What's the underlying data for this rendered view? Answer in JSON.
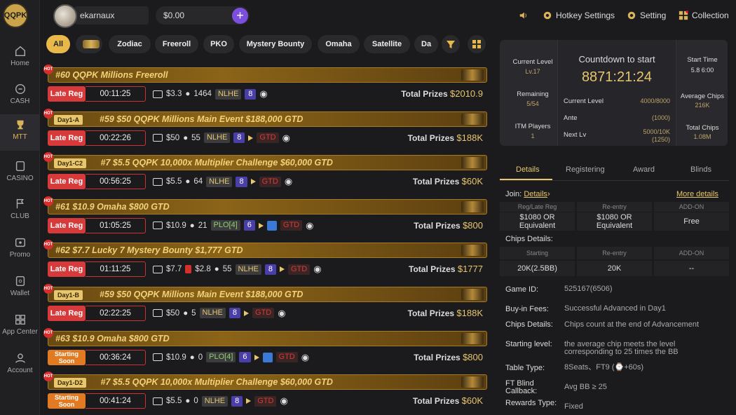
{
  "app": {
    "logo_text": "QQPK"
  },
  "sidebar": {
    "items": [
      {
        "label": "Home",
        "icon": "home-icon"
      },
      {
        "label": "CASH",
        "icon": "cash-icon"
      },
      {
        "label": "MTT",
        "icon": "trophy-icon",
        "active": true
      },
      {
        "label": "CASINO",
        "icon": "casino-icon"
      },
      {
        "label": "CLUB",
        "icon": "flag-icon"
      },
      {
        "label": "Promo",
        "icon": "promo-icon"
      },
      {
        "label": "Wallet",
        "icon": "wallet-icon"
      },
      {
        "label": "App Center",
        "icon": "grid-icon"
      },
      {
        "label": "Account",
        "icon": "user-icon"
      }
    ]
  },
  "header": {
    "username": "ekarnaux",
    "balance": "$0.00",
    "plus": "+",
    "hotkey_label": "Hotkey Settings",
    "setting_label": "Setting",
    "collection_label": "Collection"
  },
  "filters": {
    "chips": [
      "All",
      "Zodiac",
      "Freeroll",
      "PKO",
      "Mystery Bounty",
      "Omaha",
      "Satellite",
      "Da"
    ]
  },
  "tournaments": [
    {
      "stage": "",
      "name": "#60 QQPK Millions Freeroll",
      "reg": "Late Reg",
      "time": "00:11:25",
      "buyin": "$3.3",
      "players": "1464",
      "game": "NLHE",
      "seats": "8",
      "extras": [],
      "prizes": "$2010.9"
    },
    {
      "stage": "Day1-A",
      "name": "#59 $50 QQPK Millions Main Event $188,000 GTD",
      "reg": "Late Reg",
      "time": "00:22:26",
      "buyin": "$50",
      "players": "55",
      "game": "NLHE",
      "seats": "8",
      "extras": [
        "play",
        "GTD"
      ],
      "prizes": "$188K"
    },
    {
      "stage": "Day1-C2",
      "name": "#7 $5.5 QQPK 10,000x Multiplier Challenge $60,000 GTD",
      "reg": "Late Reg",
      "time": "00:56:25",
      "buyin": "$5.5",
      "players": "64",
      "game": "NLHE",
      "seats": "8",
      "extras": [
        "play",
        "GTD"
      ],
      "prizes": "$60K"
    },
    {
      "stage": "",
      "name": "#61 $10.9 Omaha $800 GTD",
      "reg": "Late Reg",
      "time": "01:05:25",
      "buyin": "$10.9",
      "players": "21",
      "game": "PLO[4]",
      "seats": "6",
      "extras": [
        "play",
        "Y",
        "GTD"
      ],
      "prizes": "$800"
    },
    {
      "stage": "",
      "name": "#62 $7.7 Lucky 7 Mystery Bounty $1,777 GTD",
      "reg": "Late Reg",
      "time": "01:11:25",
      "buyin": "$7.7",
      "bounty": "$2.8",
      "players": "55",
      "game": "NLHE",
      "seats": "8",
      "extras": [
        "play",
        "GTD"
      ],
      "prizes": "$1777"
    },
    {
      "stage": "Day1-B",
      "name": "#59 $50 QQPK Millions Main Event $188,000 GTD",
      "reg": "Late Reg",
      "time": "02:22:25",
      "buyin": "$50",
      "players": "5",
      "game": "NLHE",
      "seats": "8",
      "extras": [
        "play",
        "GTD"
      ],
      "prizes": "$188K"
    },
    {
      "stage": "",
      "name": "#63 $10.9 Omaha $800 GTD",
      "reg": "Starting Soon",
      "time": "00:36:24",
      "buyin": "$10.9",
      "players": "0",
      "game": "PLO[4]",
      "seats": "6",
      "extras": [
        "play",
        "Y",
        "GTD"
      ],
      "prizes": "$800"
    },
    {
      "stage": "Day1-D2",
      "name": "#7 $5.5 QQPK 10,000x Multiplier Challenge $60,000 GTD",
      "reg": "Starting Soon",
      "time": "00:41:24",
      "buyin": "$5.5",
      "players": "0",
      "game": "NLHE",
      "seats": "8",
      "extras": [
        "play",
        "GTD"
      ],
      "prizes": "$60K"
    }
  ],
  "labels": {
    "total_prizes": "Total Prizes",
    "hot": "HOT"
  },
  "panel": {
    "current_level_label": "Current Level",
    "current_level": "Lv.17",
    "remaining_label": "Remaining",
    "remaining": "5/54",
    "itm_label": "ITM Players",
    "itm": "1",
    "countdown_label": "Countdown to start",
    "countdown": "8871:21:24",
    "cl_label": "Current Level",
    "cl_value": "4000/8000",
    "ante_label": "Ante",
    "ante_value": "(1000)",
    "next_label": "Next Lv",
    "next_value": "5000/10K",
    "next_sub": "(1250)",
    "start_label": "Start Time",
    "start_value": "5.8 6:00",
    "avg_label": "Average Chips",
    "avg_value": "216K",
    "total_label": "Total Chips",
    "total_value": "1.08M",
    "tabs": [
      "Details",
      "Registering",
      "Award",
      "Blinds"
    ],
    "join_label": "Join:",
    "join_link": "Details",
    "more_details": "More details",
    "reg_head": "Reg/Late Reg",
    "reentry_head": "Re-entry",
    "addon_head": "ADD-ON",
    "reg_val": "$1080 OR Equivalent",
    "reentry_val": "$1080 OR Equivalent",
    "addon_val": "Free",
    "chips_title": "Chips Details:",
    "starting_head": "Starting",
    "reentry_head2": "Re-entry",
    "addon_head2": "ADD-ON",
    "starting_val": "20K(2.5BB)",
    "reentry_val2": "20K",
    "addon_val2": "--",
    "game_id_label": "Game ID:",
    "game_id": "525167(6506)",
    "buyin_fees_label": "Buy-in Fees:",
    "buyin_fees": "Successful Advanced in Day1",
    "chips_details_label": "Chips Details:",
    "chips_details": "Chips count at the end of Advancement",
    "starting_level_label": "Starting level:",
    "starting_level": "the average chip meets the level corresponding to 25 times the BB",
    "table_type_label": "Table Type:",
    "table_type": "8Seats、FT9 (⌚+60s)",
    "ft_blind_label": "FT Blind Callback:",
    "ft_blind": "Avg BB ≥ 25",
    "rewards_label": "Rewards Type:",
    "rewards": "Fixed"
  }
}
